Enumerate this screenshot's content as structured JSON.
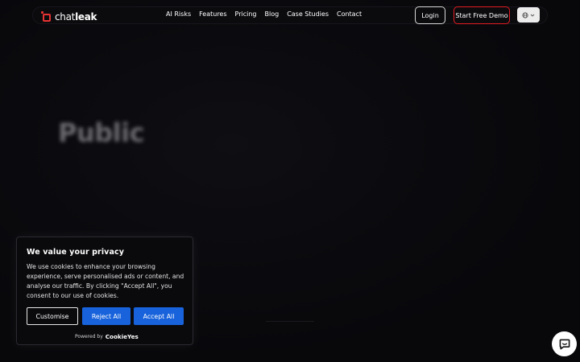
{
  "nav": {
    "logo_light": "chat",
    "logo_bold": "leak",
    "items": [
      "AI Risks",
      "Features",
      "Pricing",
      "Blog",
      "Case Studies",
      "Contact"
    ],
    "login_label": "Login",
    "demo_label": "Start Free Demo",
    "lang_icon": "globe-icon"
  },
  "hero": {
    "heading": "Public"
  },
  "cookie": {
    "title": "We value your privacy",
    "body": "We use cookies to enhance your browsing experience, serve personalised ads or content, and analyse our traffic. By clicking \"Accept All\", you consent to our use of cookies.",
    "customise_label": "Customise",
    "reject_label": "Reject All",
    "accept_label": "Accept All",
    "powered_by": "Powered by",
    "brand": "CookieYes"
  },
  "colors": {
    "accent_red": "#e11b22",
    "cookie_blue": "#1863dc"
  },
  "chat": {
    "icon": "chat-bubble-icon"
  }
}
